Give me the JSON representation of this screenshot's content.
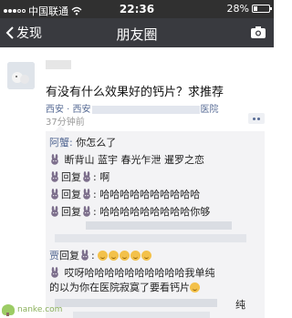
{
  "status_bar": {
    "carrier": "中国联通",
    "time": "22:36",
    "battery_label": "28%",
    "battery_level": 0.28
  },
  "nav": {
    "back_label": "发现",
    "title": "朋友圈"
  },
  "post": {
    "text": "有没有什么效果好的钙片？求推荐",
    "location_prefix": "西安 · 西安",
    "location_suffix": "医院",
    "time_ago": "37分钟前"
  },
  "comments": {
    "c1_name": "阿蟹:",
    "c1_text": " 你怎么了",
    "c2_text": " 断背山  蓝宇  春光乍泄  暹罗之恋",
    "c3_reply": "回复",
    "c3_text": ": 啊",
    "c4_reply": "回复",
    "c4_text": ": 哈哈哈哈哈哈哈哈哈哈",
    "c5_reply": "回复",
    "c5_text": ": 哈哈哈哈哈哈哈哈哈你够",
    "c6_name": "贾",
    "c6_reply": "回复",
    "c6_colon": ":",
    "c7_text": " 哎呀哈哈哈哈哈哈哈哈哈哈我单纯",
    "c8_text": "的以为你在医院寂寞了要看钙片",
    "c9_text": "纯"
  },
  "watermark": {
    "text": "nanke.com"
  },
  "colors": {
    "status_bg": "#303030",
    "nav_bg": "#393a3f",
    "link": "#576b95",
    "comment_bg": "#f3f3f5"
  }
}
